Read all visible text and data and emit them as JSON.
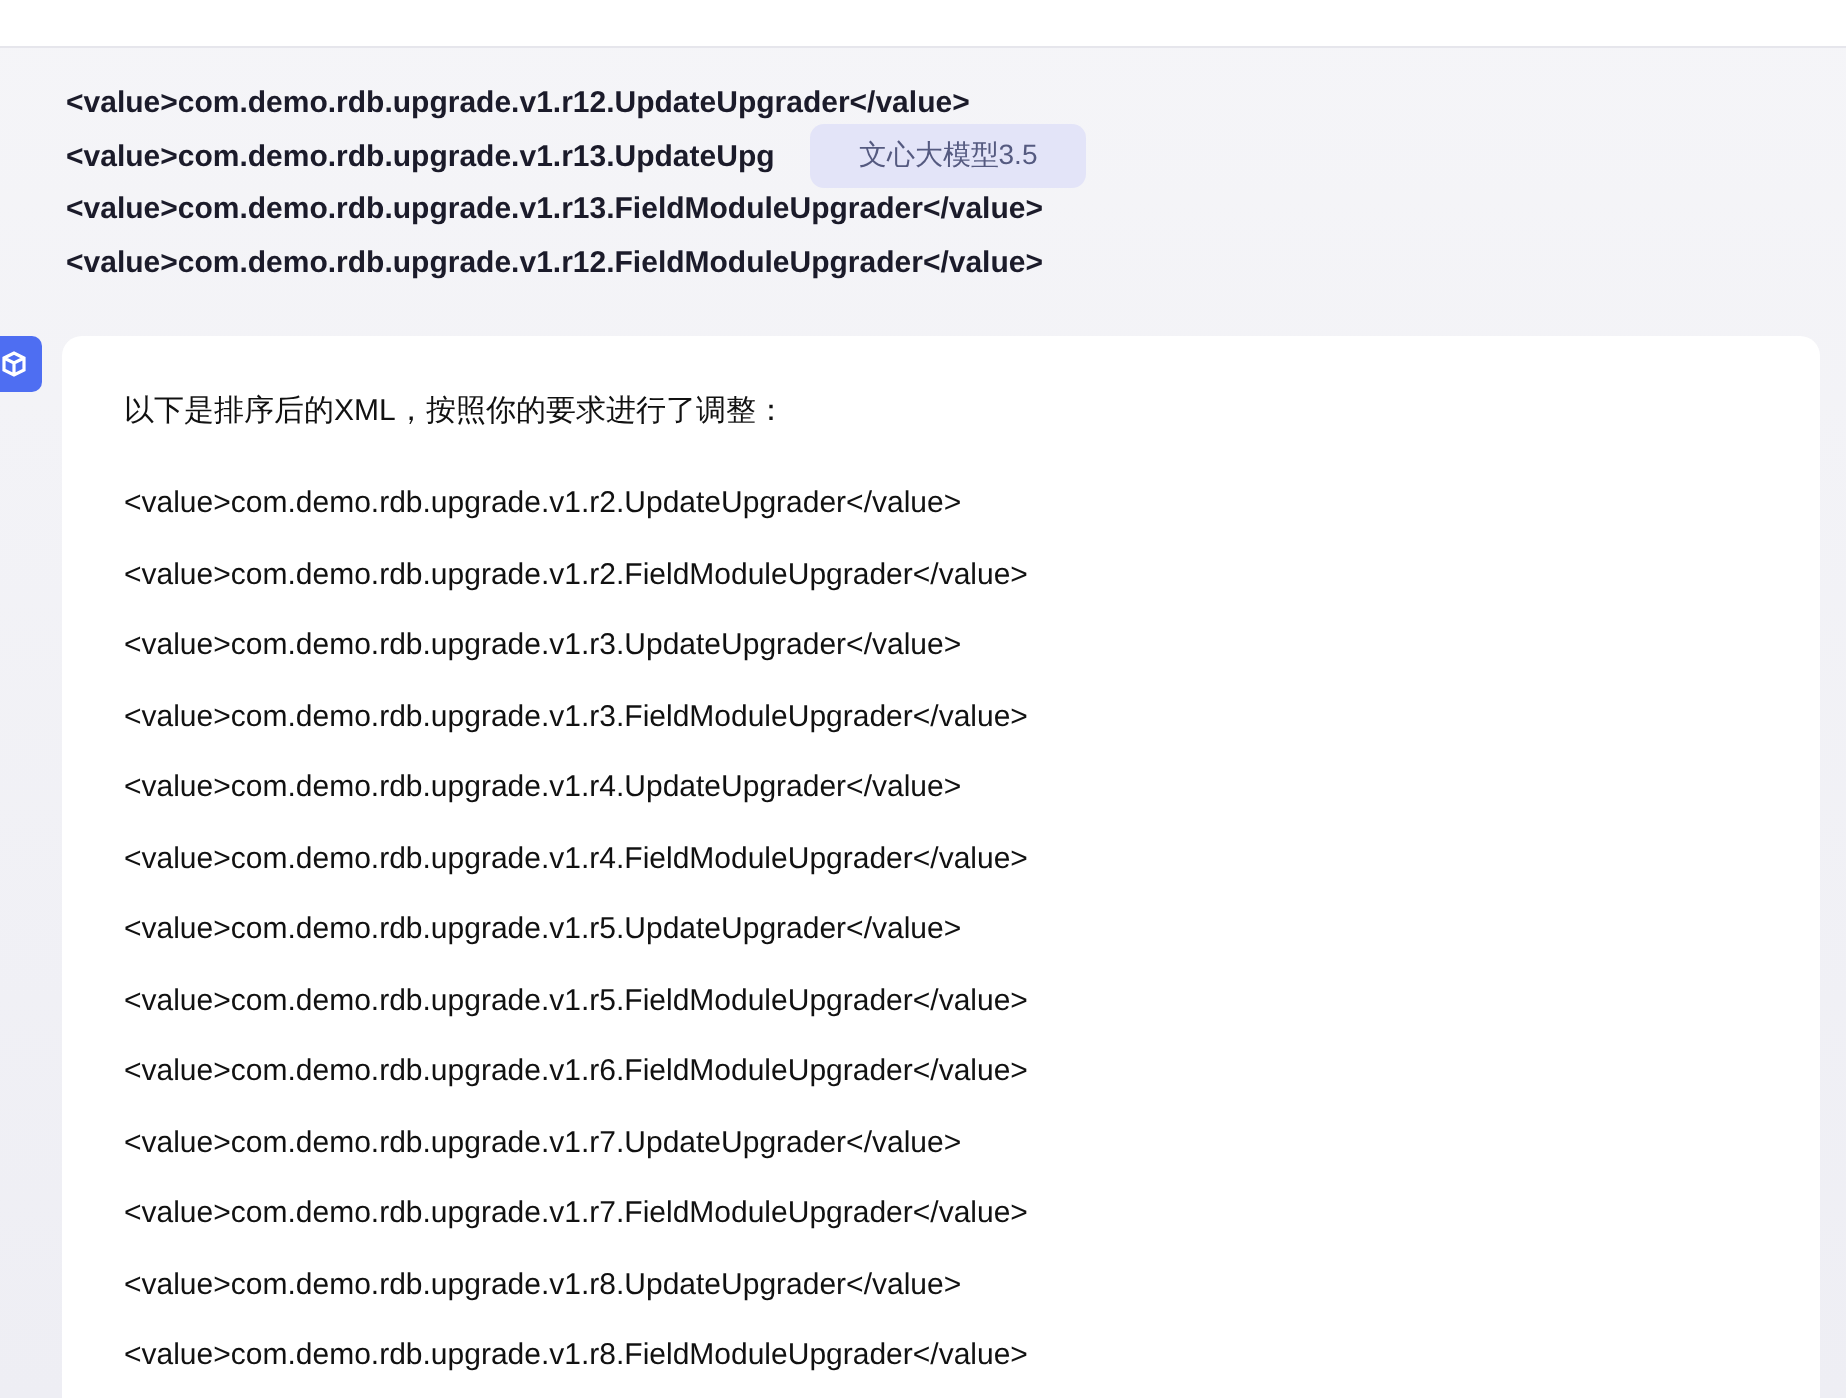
{
  "user_message": {
    "lines": [
      "<value>com.demo.rdb.upgrade.v1.r12.UpdateUpgrader</value>",
      "<value>com.demo.rdb.upgrade.v1.r13.UpdateUpg",
      "<value>com.demo.rdb.upgrade.v1.r13.FieldModuleUpgrader</value>",
      "<value>com.demo.rdb.upgrade.v1.r12.FieldModuleUpgrader</value>"
    ]
  },
  "tooltip": {
    "text": "文心大模型3.5"
  },
  "reply": {
    "intro": "以下是排序后的XML，按照你的要求进行了调整：",
    "lines": [
      "<value>com.demo.rdb.upgrade.v1.r2.UpdateUpgrader</value>",
      "<value>com.demo.rdb.upgrade.v1.r2.FieldModuleUpgrader</value>",
      "<value>com.demo.rdb.upgrade.v1.r3.UpdateUpgrader</value>",
      "<value>com.demo.rdb.upgrade.v1.r3.FieldModuleUpgrader</value>",
      "<value>com.demo.rdb.upgrade.v1.r4.UpdateUpgrader</value>",
      "<value>com.demo.rdb.upgrade.v1.r4.FieldModuleUpgrader</value>",
      "<value>com.demo.rdb.upgrade.v1.r5.UpdateUpgrader</value>",
      "<value>com.demo.rdb.upgrade.v1.r5.FieldModuleUpgrader</value>",
      "<value>com.demo.rdb.upgrade.v1.r6.FieldModuleUpgrader</value>",
      "<value>com.demo.rdb.upgrade.v1.r7.UpdateUpgrader</value>",
      "<value>com.demo.rdb.upgrade.v1.r7.FieldModuleUpgrader</value>",
      "<value>com.demo.rdb.upgrade.v1.r8.UpdateUpgrader</value>",
      "<value>com.demo.rdb.upgrade.v1.r8.FieldModuleUpgrader</value>"
    ]
  }
}
